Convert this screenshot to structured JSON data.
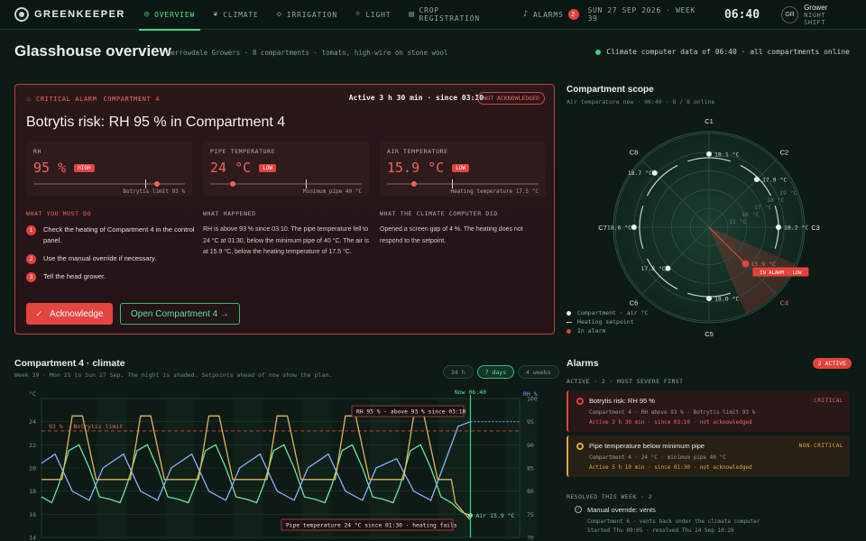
{
  "app": {
    "brand": "GREENKEEPER"
  },
  "nav": [
    {
      "label": "OVERVIEW",
      "icon": "target-icon"
    },
    {
      "label": "CLIMATE",
      "icon": "leaf-icon"
    },
    {
      "label": "IRRIGATION",
      "icon": "droplet-icon"
    },
    {
      "label": "LIGHT",
      "icon": "sun-icon"
    },
    {
      "label": "CROP REGISTRATION",
      "icon": "clipboard-icon"
    },
    {
      "label": "ALARMS",
      "icon": "bell-icon",
      "count": "2"
    }
  ],
  "topbar": {
    "date": "SUN 27 SEP 2026 · WEEK 39",
    "time": "06:40",
    "user_initials": "GR",
    "user_name": "Grower",
    "user_role": "NIGHT SHIFT"
  },
  "page": {
    "title": "Glasshouse overview",
    "subtitle": "Merrowdale Growers · 8 compartments · tomato, high-wire on stone wool",
    "status": "Climate computer data of 06:40 · all compartments online"
  },
  "alarm": {
    "kicker": "CRITICAL ALARM",
    "compartment": "COMPARTMENT 4",
    "active": "Active 3 h 30 min · since 03:10",
    "ack_status": "NOT ACKNOWLEDGED",
    "title": "Botrytis risk: RH 95 % in Compartment 4",
    "measurements": [
      {
        "label": "RH",
        "value": "95 %",
        "tag": "HIGH",
        "note": "Botrytis limit 93 %",
        "position": 0.8,
        "limit": 0.74
      },
      {
        "label": "PIPE TEMPERATURE",
        "value": "24 °C",
        "tag": "LOW",
        "note": "Minimum pipe 40 °C",
        "position": 0.13,
        "limit": 0.63
      },
      {
        "label": "AIR TEMPERATURE",
        "value": "15.9 °C",
        "tag": "LOW",
        "note": "Heating temperature 17.5 °C",
        "position": 0.16,
        "limit": 0.43
      }
    ],
    "must_do_head": "WHAT YOU MUST DO",
    "steps": [
      "Check the heating of Compartment 4 in the control panel.",
      "Use the manual override if necessary.",
      "Tell the head grower."
    ],
    "happened_head": "WHAT HAPPENED",
    "happened": "RH is above 93 % since 03:10. The pipe temperature fell to 24 °C at 01:30, below the minimum pipe of 40 °C. The air is at 15.9 °C, below the heating temperature of 17.5 °C.",
    "did_head": "WHAT THE CLIMATE COMPUTER DID",
    "did": "Opened a screen gap of 4 %. The heating does not respond to the setpoint.",
    "ack_label": "Acknowledge",
    "open_label": "Open Compartment 4 →"
  },
  "scope": {
    "title": "Compartment scope",
    "subtitle": "Air temperature now · 06:40 · 8 / 8 online",
    "compartments": [
      {
        "name": "C1",
        "value": "18.1 °C",
        "alarm": false
      },
      {
        "name": "C2",
        "value": "17.9 °C",
        "alarm": false
      },
      {
        "name": "C3",
        "value": "18.2 °C",
        "alarm": false
      },
      {
        "name": "C4",
        "value": "15.9 °C",
        "alarm": true
      },
      {
        "name": "C5",
        "value": "18.0 °C",
        "alarm": false
      },
      {
        "name": "C6",
        "value": "17.8 °C",
        "alarm": false
      },
      {
        "name": "C7",
        "value": "18.6 °C",
        "alarm": false
      },
      {
        "name": "C8",
        "value": "18.7 °C",
        "alarm": false
      }
    ],
    "ring_labels": [
      "15 °C",
      "16 °C",
      "17 °C",
      "18 °C",
      "19 °C"
    ],
    "in_alarm_label": "IN ALARM · LOW",
    "legend": [
      "Compartment · air °C",
      "Heating setpoint",
      "In alarm"
    ]
  },
  "climate": {
    "title": "Compartment 4 · climate",
    "subtitle": "Week 39 · Mon 21 to Sun 27 Sep. The night is shaded. Setpoints ahead of now show the plan.",
    "ranges": [
      "24 h",
      "7 days",
      "4 weeks"
    ],
    "active_range": "7 days",
    "left_unit": "°C",
    "right_unit": "RH %",
    "now_label": "Now 06:40",
    "annotations": [
      "93 % · Botrytis limit",
      "RH 95 % · above 93 % since 03:10",
      "Pipe temperature 24 °C since 01:30 · heating fails",
      "Air 15.9 °C"
    ]
  },
  "chart_data": {
    "type": "line",
    "x_unit": "day of week 39",
    "ylabel": "°C",
    "ylabel_right": "RH %",
    "ylim": [
      14,
      26
    ],
    "ylim_right": [
      70,
      100
    ],
    "yticks": [
      14,
      16,
      18,
      20,
      22,
      24
    ],
    "yticks_right": [
      70,
      75,
      80,
      85,
      90,
      95,
      100
    ],
    "xlim": [
      0,
      7
    ],
    "now_x": 6.28,
    "series": [
      {
        "name": "Air",
        "axis": "left",
        "x": [
          0,
          0.15,
          0.25,
          0.4,
          0.55,
          0.7,
          0.85,
          1,
          1.15,
          1.25,
          1.4,
          1.55,
          1.7,
          1.85,
          2,
          2.15,
          2.25,
          2.4,
          2.55,
          2.7,
          2.85,
          3,
          3.15,
          3.25,
          3.4,
          3.55,
          3.7,
          3.85,
          4,
          4.15,
          4.25,
          4.4,
          4.55,
          4.7,
          4.85,
          5,
          5.15,
          5.25,
          5.4,
          5.55,
          5.7,
          5.85,
          6,
          6.15,
          6.28
        ],
        "y": [
          17.5,
          17.0,
          18.5,
          21.5,
          22.0,
          20.0,
          17.5,
          17.3,
          17.0,
          18.5,
          21.5,
          22.0,
          20.0,
          17.5,
          17.3,
          17.0,
          18.5,
          21.5,
          22.0,
          20.0,
          17.5,
          17.3,
          17.0,
          18.5,
          21.5,
          22.0,
          20.0,
          17.5,
          17.3,
          17.0,
          18.5,
          21.5,
          22.0,
          20.0,
          17.5,
          17.3,
          17.0,
          18.5,
          21.5,
          22.0,
          20.0,
          17.5,
          17.0,
          16.2,
          15.9
        ]
      },
      {
        "name": "RH",
        "axis": "right",
        "x": [
          0,
          0.2,
          0.45,
          0.7,
          0.9,
          1.2,
          1.45,
          1.7,
          1.9,
          2.2,
          2.45,
          2.7,
          2.9,
          3.2,
          3.45,
          3.7,
          3.9,
          4.2,
          4.45,
          4.7,
          4.9,
          5.2,
          5.45,
          5.7,
          5.9,
          6.1,
          6.28
        ],
        "y": [
          86,
          88,
          80,
          78,
          85,
          88,
          80,
          78,
          85,
          88,
          80,
          78,
          85,
          88,
          80,
          78,
          85,
          88,
          80,
          78,
          85,
          87,
          80,
          78,
          86,
          94,
          95
        ]
      },
      {
        "name": "Pipe temperature",
        "axis": "left",
        "x": [
          0,
          0.3,
          0.45,
          0.6,
          0.8,
          1,
          1.3,
          1.45,
          1.6,
          1.8,
          2,
          2.3,
          2.45,
          2.6,
          2.8,
          3,
          3.3,
          3.45,
          3.6,
          3.8,
          4,
          4.3,
          4.45,
          4.6,
          4.8,
          5,
          5.3,
          5.45,
          5.6,
          5.8,
          6.0,
          6.06,
          6.28
        ],
        "y": [
          19,
          19,
          24.5,
          24.5,
          19,
          19,
          19,
          24.5,
          24.5,
          19,
          19,
          19,
          24.5,
          24.5,
          19,
          19,
          19,
          24.5,
          24.5,
          19,
          19,
          19,
          24.5,
          24.5,
          19,
          19,
          19,
          24.5,
          24.5,
          19,
          19,
          17.0,
          15.5
        ]
      }
    ]
  }
}
